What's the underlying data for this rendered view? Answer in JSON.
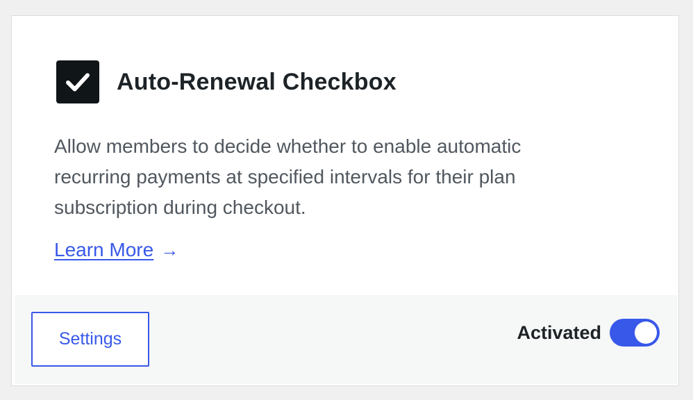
{
  "card": {
    "title": "Auto-Renewal Checkbox",
    "icon": "checkbox-checked-icon",
    "description": "Allow members to decide whether to enable automatic recurring payments at specified intervals for their plan subscription during checkout.",
    "learn_more_label": "Learn More",
    "learn_more_arrow": "→"
  },
  "footer": {
    "settings_label": "Settings",
    "status_label": "Activated",
    "toggle_on": true
  },
  "colors": {
    "accent": "#3858e9",
    "title": "#1d2327",
    "text": "#50575e",
    "footer_bg": "#f6f7f7"
  }
}
